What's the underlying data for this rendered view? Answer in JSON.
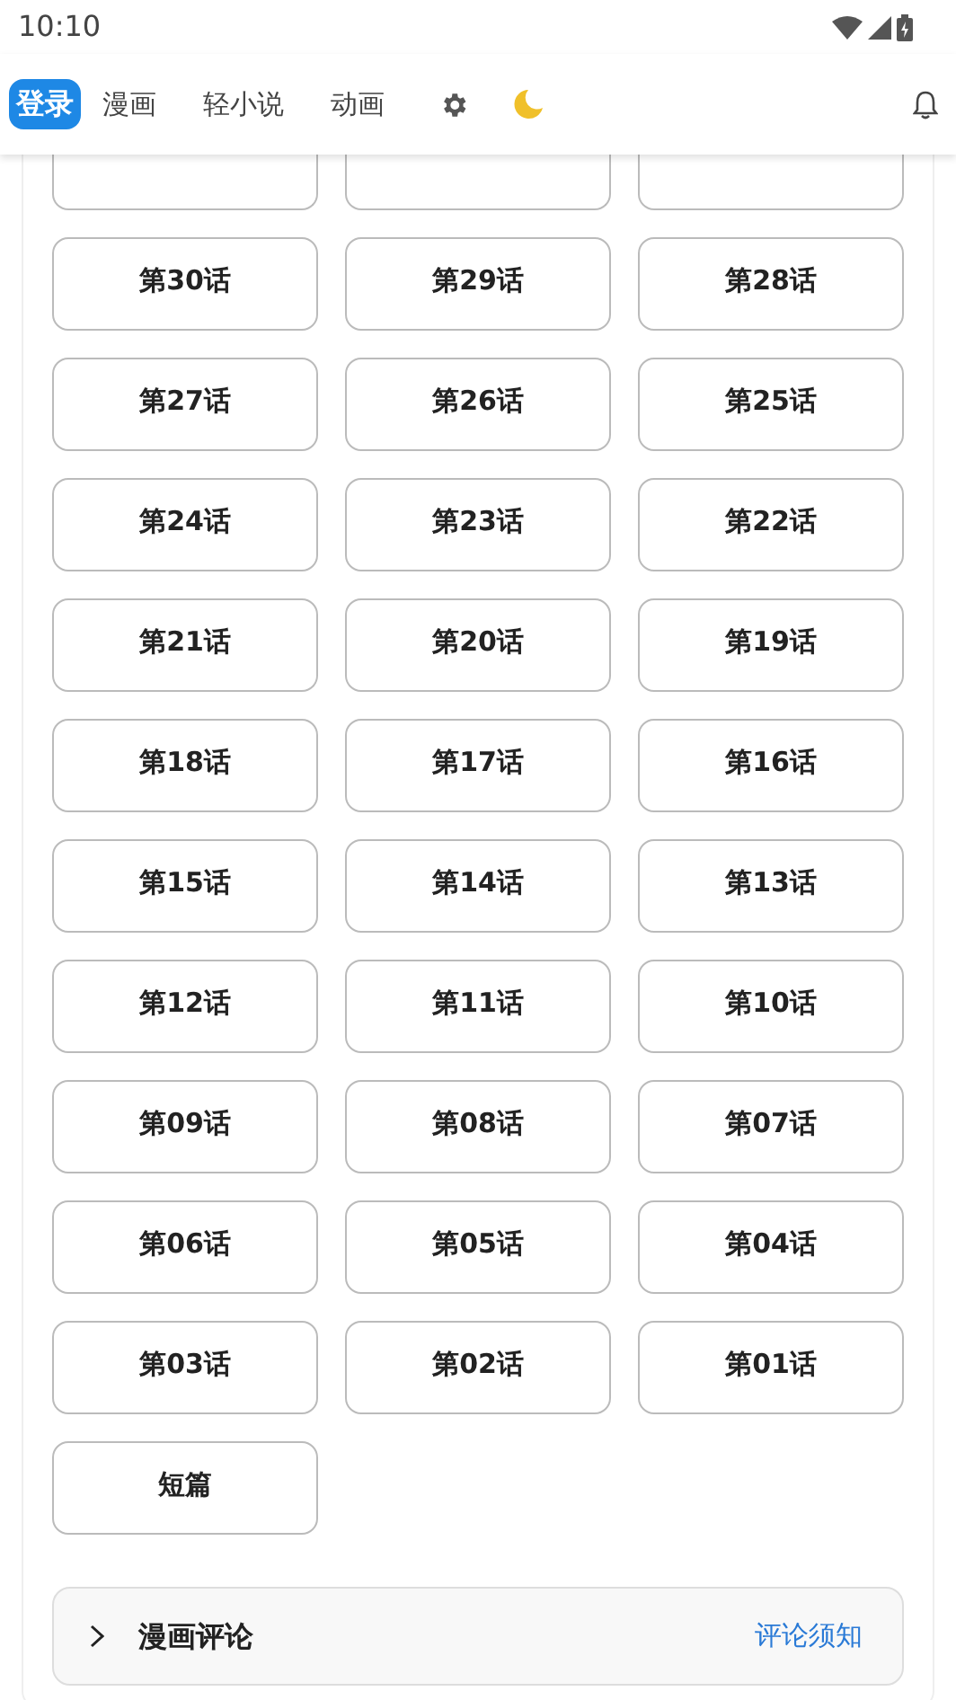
{
  "status_bar": {
    "time": "10:10"
  },
  "nav": {
    "tabs": [
      {
        "label": "登录",
        "selected": true
      },
      {
        "label": "漫画",
        "selected": false
      },
      {
        "label": "轻小说",
        "selected": false
      },
      {
        "label": "动画",
        "selected": false
      }
    ]
  },
  "chapters": [
    "第30话",
    "第29话",
    "第28话",
    "第27话",
    "第26话",
    "第25话",
    "第24话",
    "第23话",
    "第22话",
    "第21话",
    "第20话",
    "第19话",
    "第18话",
    "第17话",
    "第16话",
    "第15话",
    "第14话",
    "第13话",
    "第12话",
    "第11话",
    "第10话",
    "第09话",
    "第08话",
    "第07话",
    "第06话",
    "第05话",
    "第04话",
    "第03话",
    "第02话",
    "第01话",
    "短篇"
  ],
  "comments": {
    "title": "漫画评论",
    "expanded": false,
    "link": "评论须知"
  }
}
